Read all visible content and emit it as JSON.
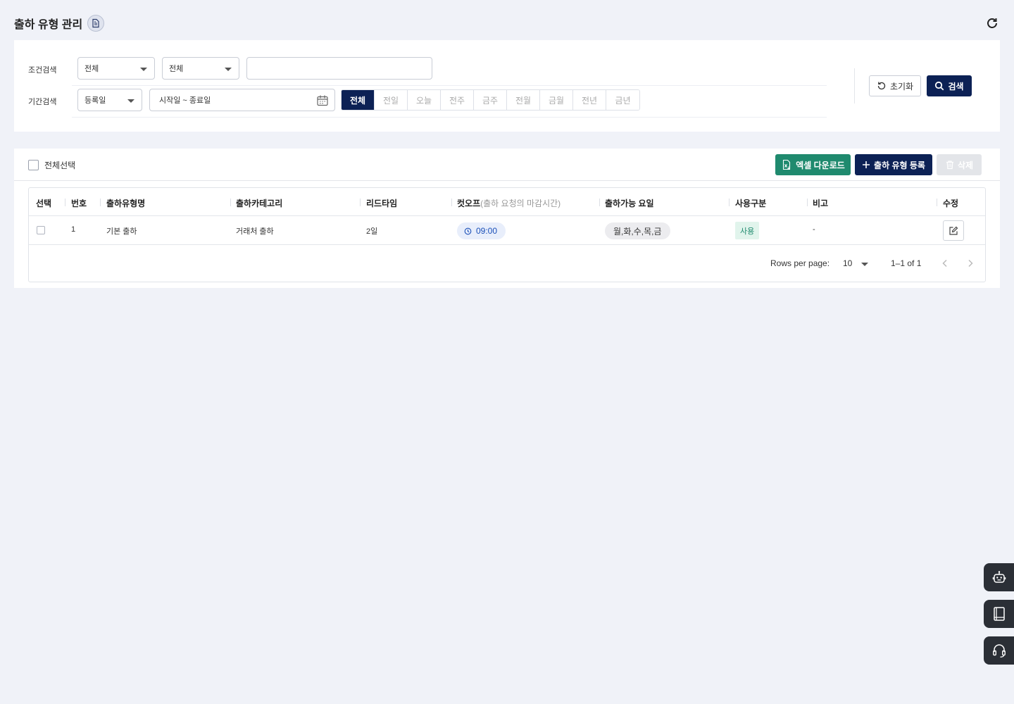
{
  "page": {
    "title": "출하 유형 관리"
  },
  "filters": {
    "condition_label": "조건검색",
    "condition_select_1": "전체",
    "condition_select_2": "전체",
    "keyword_value": "",
    "period_label": "기간검색",
    "date_type_select": "등록일",
    "date_range_placeholder": "시작일 ~ 종료일",
    "period_buttons": [
      "전체",
      "전일",
      "오늘",
      "전주",
      "금주",
      "전월",
      "금월",
      "전년",
      "금년"
    ],
    "active_period": "전체",
    "reset_label": "초기화",
    "search_label": "검색"
  },
  "toolbar": {
    "select_all_label": "전체선택",
    "excel_label": "엑셀 다운로드",
    "add_label": "출하 유형 등록",
    "delete_label": "삭제"
  },
  "table": {
    "headers": {
      "select": "선택",
      "no": "번호",
      "name": "출하유형명",
      "category": "출하카테고리",
      "lead_time": "리드타임",
      "cutoff": "컷오프",
      "cutoff_sub": "(출하 요청의 마감시간)",
      "days": "출하가능 요일",
      "usage": "사용구분",
      "note": "비고",
      "edit": "수정"
    },
    "rows": [
      {
        "no": "1",
        "name": "기본 출하",
        "category": "거래처 출하",
        "lead_time": "2일",
        "cutoff": "09:00",
        "days": "월,화,수,목,금",
        "usage": "사용",
        "note": "-"
      }
    ]
  },
  "pagination": {
    "rows_per_page_label": "Rows per page:",
    "rows_per_page": "10",
    "range": "1–1 of 1"
  },
  "colors": {
    "primary": "#0c2155",
    "excel": "#1f8a6e",
    "background": "#f0f2f8"
  }
}
